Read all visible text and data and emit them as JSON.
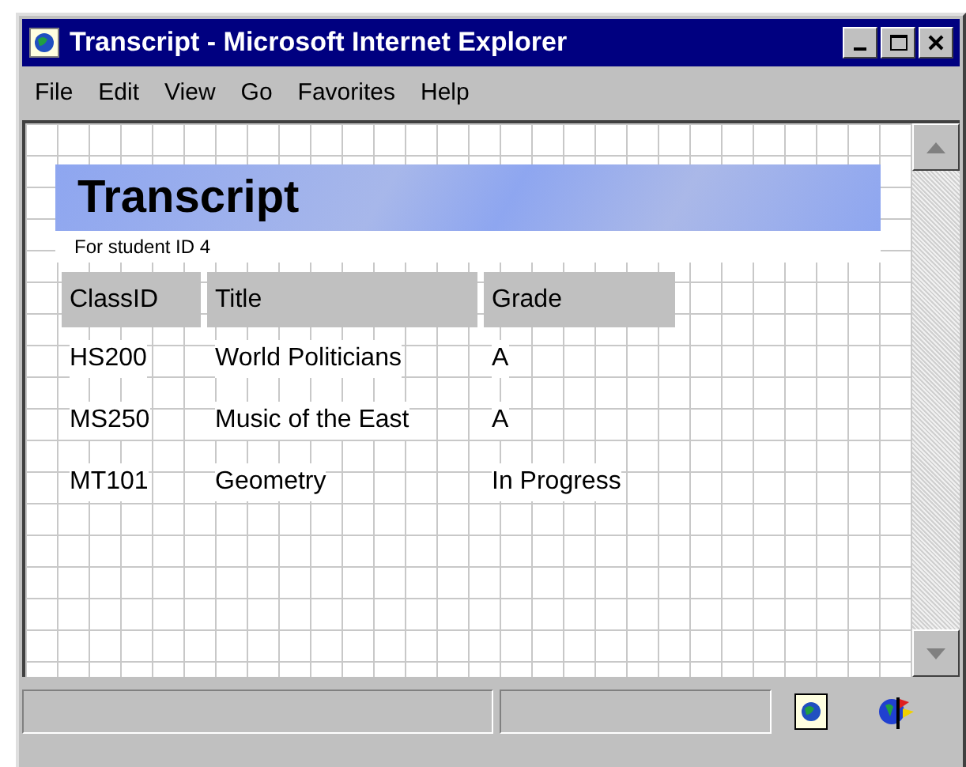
{
  "window": {
    "title": "Transcript - Microsoft Internet Explorer"
  },
  "menu": [
    "File",
    "Edit",
    "View",
    "Go",
    "Favorites",
    "Help"
  ],
  "page": {
    "heading": "Transcript",
    "subtitle": "For student ID 4",
    "table": {
      "columns": [
        "ClassID",
        "Title",
        "Grade"
      ],
      "rows": [
        [
          "HS200",
          "World Politicians",
          "A"
        ],
        [
          "MS250",
          "Music of the East",
          "A"
        ],
        [
          "MT101",
          "Geometry",
          "In Progress"
        ]
      ]
    }
  }
}
